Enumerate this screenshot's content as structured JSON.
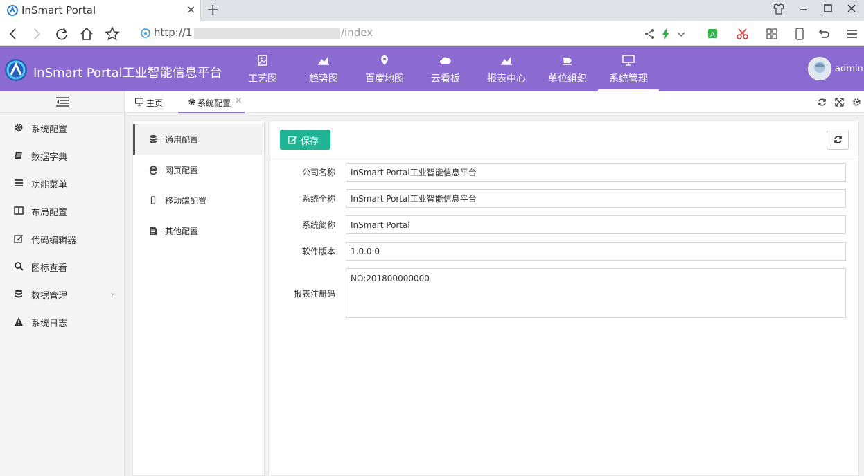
{
  "browser": {
    "tab_title": "InSmart Portal",
    "url": "http://1",
    "url_tail": "/index",
    "tab_close_glyph": "×",
    "newtab_glyph": "+"
  },
  "header": {
    "title": "InSmart Portal工业智能信息平台",
    "nav": [
      {
        "label": "工艺图",
        "icon": "image-icon"
      },
      {
        "label": "趋势图",
        "icon": "area-chart-icon"
      },
      {
        "label": "百度地图",
        "icon": "map-marker-icon"
      },
      {
        "label": "云看板",
        "icon": "cloud-icon"
      },
      {
        "label": "报表中心",
        "icon": "area-chart-icon"
      },
      {
        "label": "单位组织",
        "icon": "coffee-icon"
      },
      {
        "label": "系统管理",
        "icon": "desktop-icon",
        "active": true
      }
    ],
    "user": "admin",
    "color": "#8b6bd1"
  },
  "sidebar": {
    "items": [
      {
        "label": "系统配置",
        "icon": "gear-icon"
      },
      {
        "label": "数据字典",
        "icon": "book-icon"
      },
      {
        "label": "功能菜单",
        "icon": "list-icon"
      },
      {
        "label": "布局配置",
        "icon": "columns-icon"
      },
      {
        "label": "代码编辑器",
        "icon": "edit-icon"
      },
      {
        "label": "图标查看",
        "icon": "search-icon"
      },
      {
        "label": "数据管理",
        "icon": "database-icon",
        "has_children": true
      },
      {
        "label": "系统日志",
        "icon": "warning-icon"
      }
    ],
    "caret": "⌄"
  },
  "tabs": [
    {
      "label": "主页",
      "icon": "desktop-icon"
    },
    {
      "label": "系统配置",
      "icon": "gear-icon",
      "active": true,
      "close": "×"
    }
  ],
  "subnav": {
    "items": [
      {
        "label": "通用配置",
        "icon": "database-icon",
        "active": true
      },
      {
        "label": "网页配置",
        "icon": "internet-explorer-icon"
      },
      {
        "label": "移动端配置",
        "icon": "mobile-icon"
      },
      {
        "label": "其他配置",
        "icon": "file-text-icon"
      }
    ]
  },
  "toolbar": {
    "save_label": "保存",
    "save_color": "#1fb494"
  },
  "form": {
    "fields": [
      {
        "label": "公司名称",
        "value": "InSmart Portal工业智能信息平台"
      },
      {
        "label": "系统全称",
        "value": "InSmart Portal工业智能信息平台"
      },
      {
        "label": "系统简称",
        "value": "InSmart Portal"
      },
      {
        "label": "软件版本",
        "value": "1.0.0.0"
      },
      {
        "label": "报表注册码",
        "value": "NO:201800000000"
      }
    ]
  }
}
